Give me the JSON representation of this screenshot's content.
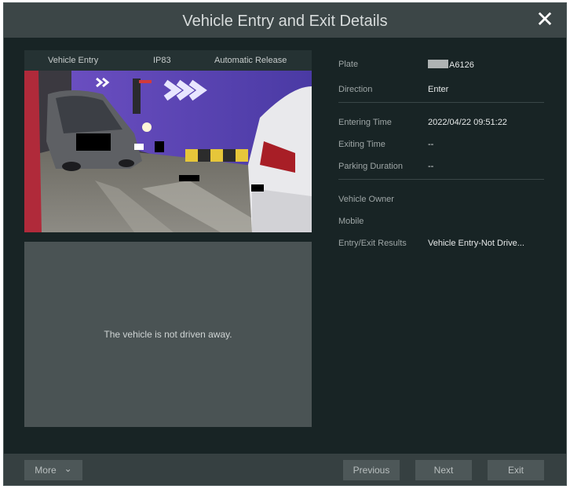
{
  "dialog": {
    "title": "Vehicle Entry and Exit Details",
    "close_glyph": "✕"
  },
  "capture": {
    "tab_entry": "Vehicle Entry",
    "tab_camera": "IP83",
    "tab_release": "Automatic Release"
  },
  "placeholder": {
    "message": "The vehicle is not driven away."
  },
  "details": {
    "plate_label": "Plate",
    "plate_value": "A6126",
    "direction_label": "Direction",
    "direction_value": "Enter",
    "entering_label": "Entering Time",
    "entering_value": "2022/04/22 09:51:22",
    "exiting_label": "Exiting Time",
    "exiting_value": "--",
    "duration_label": "Parking Duration",
    "duration_value": "--",
    "owner_label": "Vehicle Owner",
    "mobile_label": "Mobile",
    "results_label": "Entry/Exit Results",
    "results_value": "Vehicle Entry-Not Drive..."
  },
  "footer": {
    "more_label": "More",
    "more_chevron": "⌄",
    "previous_label": "Previous",
    "next_label": "Next",
    "exit_label": "Exit"
  }
}
